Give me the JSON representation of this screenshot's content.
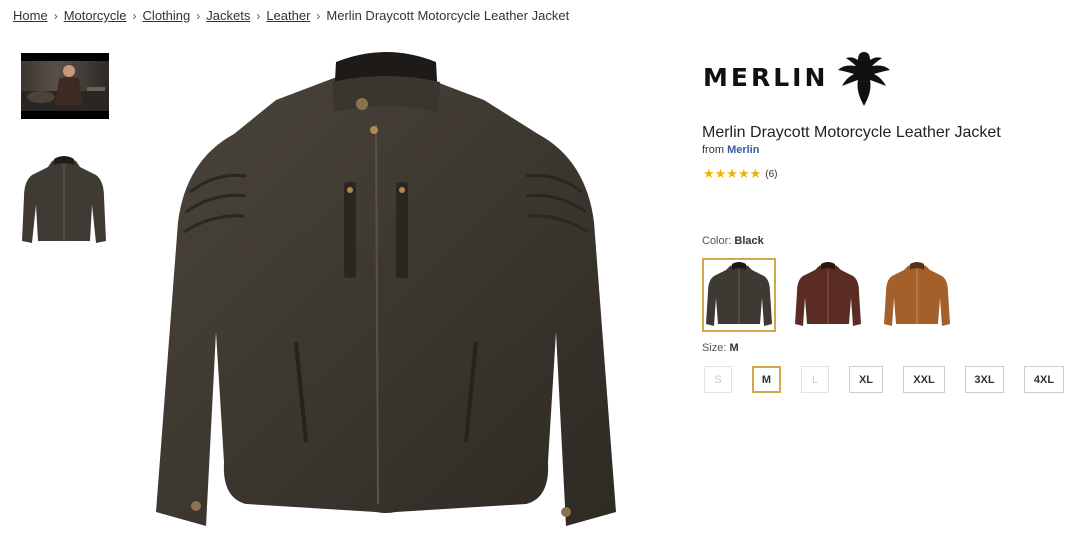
{
  "breadcrumb": {
    "items": [
      "Home",
      "Motorcycle",
      "Clothing",
      "Jackets",
      "Leather"
    ],
    "separator": "›",
    "current": "Merlin Draycott Motorcycle Leather Jacket"
  },
  "brand": {
    "logo_text": "MERLIN",
    "name": "Merlin"
  },
  "product": {
    "title": "Merlin Draycott Motorcycle Leather Jacket",
    "from_label": "from",
    "rating_stars": "★★★★★",
    "rating_value": 5,
    "review_count": "(6)"
  },
  "color": {
    "label": "Color:",
    "selected": "Black",
    "options": [
      "Black",
      "Brown",
      "Tan"
    ]
  },
  "size": {
    "label": "Size:",
    "selected": "M",
    "options": [
      "S",
      "M",
      "L",
      "XL",
      "XXL",
      "3XL",
      "4XL"
    ]
  },
  "colors": {
    "accent_border": "#d1a84a",
    "link": "#3d5aa3",
    "star": "#f0b400"
  }
}
